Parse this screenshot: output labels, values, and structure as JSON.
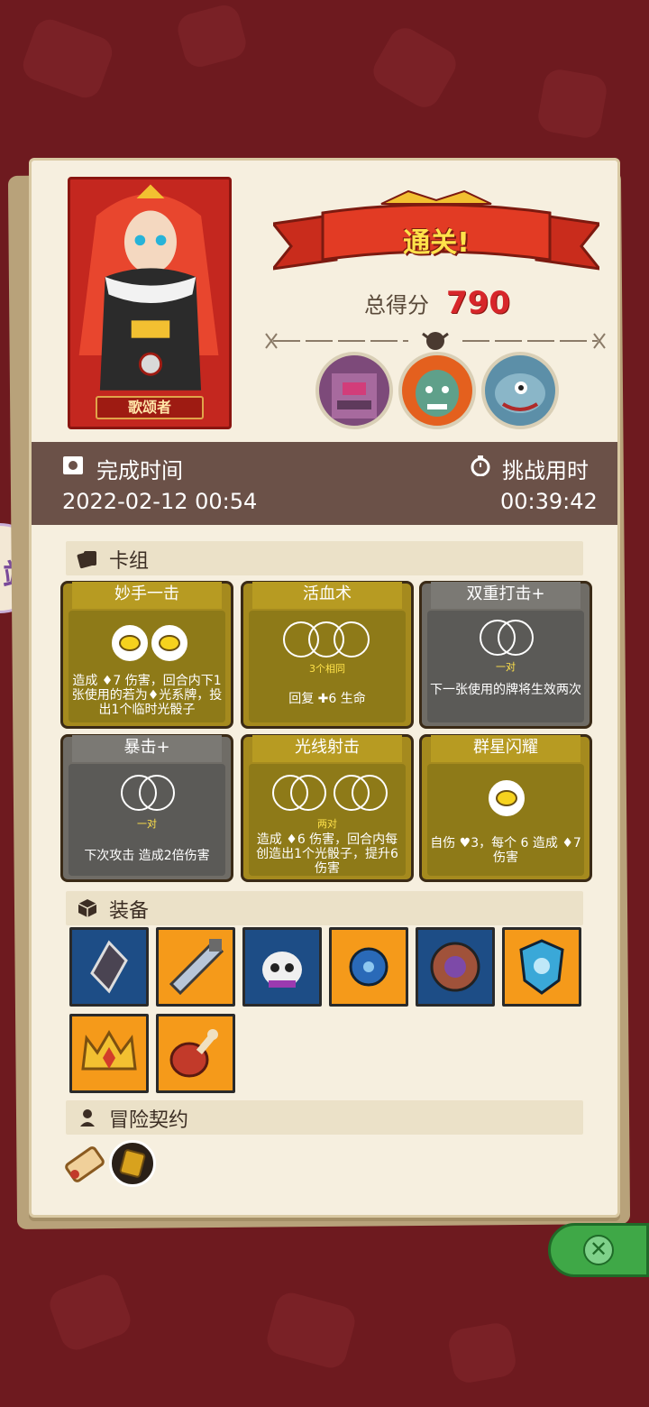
{
  "result": {
    "banner": "通关!",
    "score_label": "总得分",
    "score_value": "790"
  },
  "hero": {
    "name": "歌颂者"
  },
  "time": {
    "finish_label": "完成时间",
    "finish_value": "2022-02-12 00:54",
    "challenge_label": "挑战用时",
    "challenge_value": "00:39:42"
  },
  "sections": {
    "deck": "卡组",
    "equipment": "装备",
    "contracts": "冒险契约"
  },
  "cards": [
    {
      "title": "妙手一击",
      "style": "gold",
      "sub": "",
      "desc": "造成 ♦7 伤害，回合内下1张使用的若为♦光系牌，投出1个临时光骰子"
    },
    {
      "title": "活血术",
      "style": "gold",
      "sub": "3个相同",
      "desc": "回复 ✚6 生命"
    },
    {
      "title": "双重打击+",
      "style": "gray",
      "sub": "一对",
      "desc": "下一张使用的牌将生效两次"
    },
    {
      "title": "暴击+",
      "style": "gray",
      "sub": "一对",
      "desc": "下次攻击 造成2倍伤害"
    },
    {
      "title": "光线射击",
      "style": "gold",
      "sub": "两对",
      "desc": "造成 ♦6 伤害，回合内每创造出1个光骰子，提升6伤害"
    },
    {
      "title": "群星闪耀",
      "style": "gold",
      "sub": "",
      "desc": "自伤 ♥3，每个 6 造成 ♦7 伤害"
    }
  ],
  "equipment": [
    {
      "name": "dark-crystal-icon",
      "color": "blue"
    },
    {
      "name": "serrated-blade-icon",
      "color": "orange"
    },
    {
      "name": "horned-skull-icon",
      "color": "blue"
    },
    {
      "name": "spiked-ball-icon",
      "color": "orange"
    },
    {
      "name": "round-shield-icon",
      "color": "blue"
    },
    {
      "name": "ice-crest-icon",
      "color": "orange"
    },
    {
      "name": "gold-crown-icon",
      "color": "orange"
    },
    {
      "name": "ham-leg-icon",
      "color": "orange"
    }
  ],
  "contracts": [
    "scroll-icon",
    "dice-token-icon"
  ],
  "side_badge": "站",
  "colors": {
    "background": "#6e1a1f",
    "parchment": "#f6efdf",
    "time_bar": "#6b5148",
    "score": "#d7262a",
    "banner_text": "#ffe24a"
  }
}
